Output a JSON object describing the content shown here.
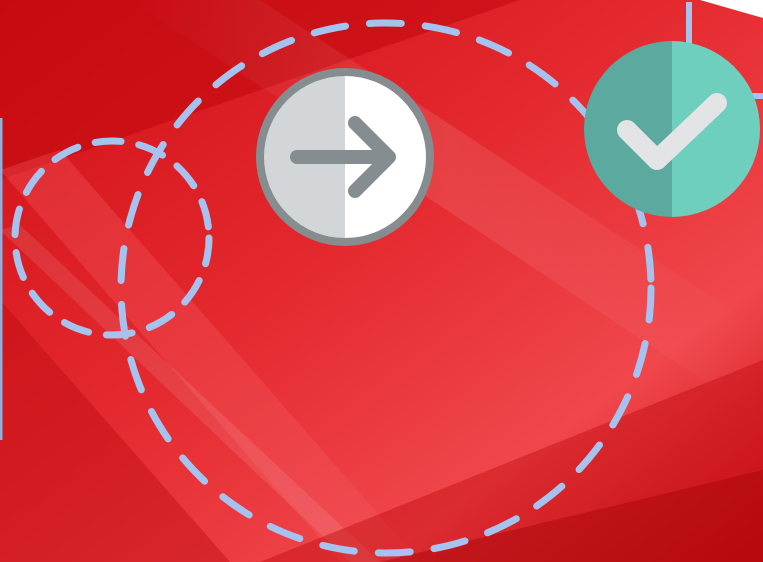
{
  "scene": {
    "background": {
      "base_color": "#d91a1f",
      "highlight_color": "#f25256",
      "shadow_color": "#b8070c"
    },
    "dashed_circles": {
      "stroke_color": "#a6c2ee"
    },
    "next_button": {
      "icon": "arrow-right-icon",
      "ring_color": "#858d91",
      "left_half_color": "#d2d6d8",
      "right_half_color": "#ffffff",
      "arrow_color": "#858d91"
    },
    "check_badge": {
      "icon": "checkmark-icon",
      "left_half_color": "#5ba99f",
      "right_half_color": "#6ecfbf",
      "check_color": "#e2e4e5"
    },
    "frame_edge": {
      "color": "#8fb0df"
    }
  }
}
